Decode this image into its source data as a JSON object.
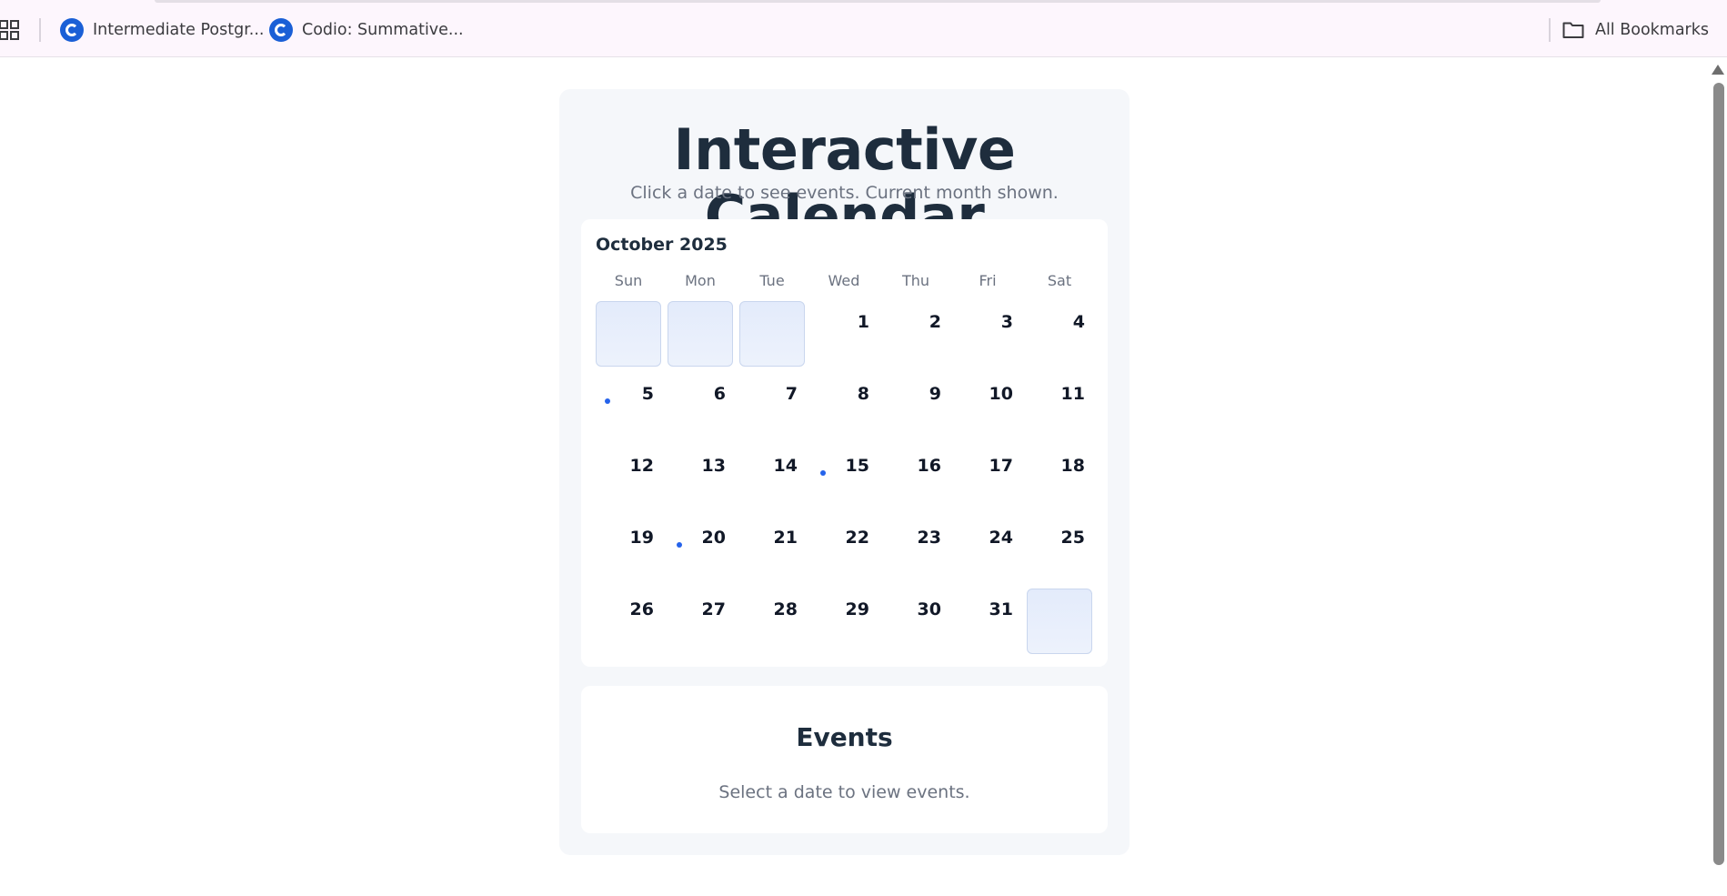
{
  "bookmarks_bar": {
    "items": [
      {
        "label": "Intermediate Postgr...",
        "icon": "codio-icon"
      },
      {
        "label": "Codio: Summative...",
        "icon": "codio-icon"
      }
    ],
    "all_bookmarks_label": "All Bookmarks"
  },
  "app": {
    "title": "Interactive Calendar",
    "subtitle": "Click a date to see events. Current month shown.",
    "calendar": {
      "month_label": "October 2025",
      "weekdays": [
        "Sun",
        "Mon",
        "Tue",
        "Wed",
        "Thu",
        "Fri",
        "Sat"
      ],
      "days": [
        {
          "day": "",
          "empty": true
        },
        {
          "day": "",
          "empty": true
        },
        {
          "day": "",
          "empty": true
        },
        {
          "day": "1"
        },
        {
          "day": "2"
        },
        {
          "day": "3"
        },
        {
          "day": "4"
        },
        {
          "day": "5",
          "has_event": true
        },
        {
          "day": "6"
        },
        {
          "day": "7"
        },
        {
          "day": "8"
        },
        {
          "day": "9"
        },
        {
          "day": "10"
        },
        {
          "day": "11"
        },
        {
          "day": "12"
        },
        {
          "day": "13"
        },
        {
          "day": "14"
        },
        {
          "day": "15",
          "has_event": true
        },
        {
          "day": "16"
        },
        {
          "day": "17"
        },
        {
          "day": "18"
        },
        {
          "day": "19"
        },
        {
          "day": "20",
          "has_event": true
        },
        {
          "day": "21"
        },
        {
          "day": "22"
        },
        {
          "day": "23"
        },
        {
          "day": "24"
        },
        {
          "day": "25"
        },
        {
          "day": "26"
        },
        {
          "day": "27"
        },
        {
          "day": "28"
        },
        {
          "day": "29"
        },
        {
          "day": "30"
        },
        {
          "day": "31"
        },
        {
          "day": "",
          "empty": true
        }
      ],
      "event_dot_color": "#2563eb"
    },
    "events": {
      "title": "Events",
      "empty_message": "Select a date to view events."
    }
  }
}
